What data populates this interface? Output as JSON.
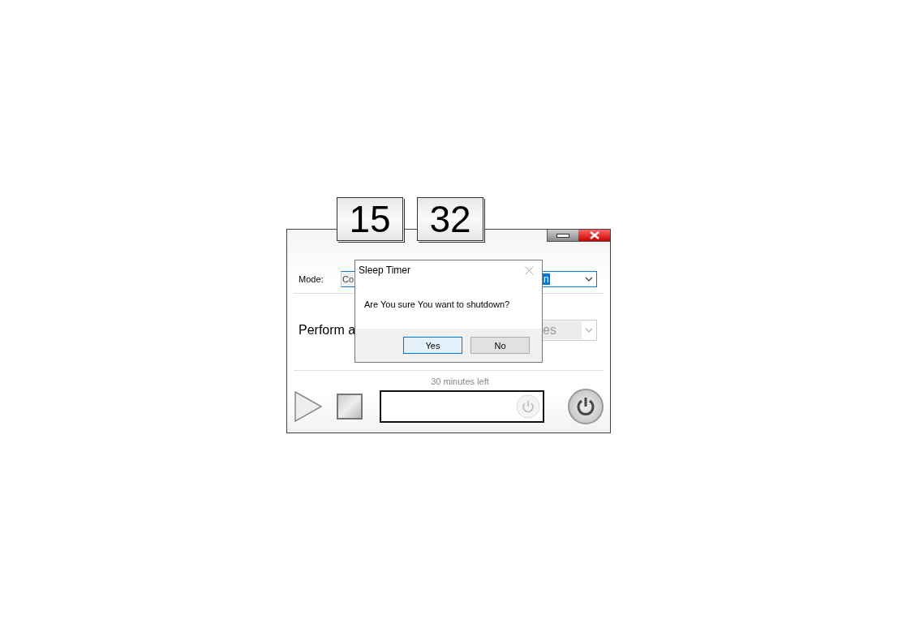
{
  "clock": {
    "hours": "15",
    "minutes": "32"
  },
  "main_window": {
    "mode_label": "Mode:",
    "mode_value": "Co",
    "mode_selection": "n",
    "action_label": "Perform a",
    "action_value": "es",
    "remaining": "30 minutes left"
  },
  "dialog": {
    "title": "Sleep Timer",
    "message": "Are You sure You want to shutdown?",
    "buttons": [
      {
        "label": "Yes",
        "selected": true
      },
      {
        "label": "No",
        "selected": false
      }
    ]
  }
}
